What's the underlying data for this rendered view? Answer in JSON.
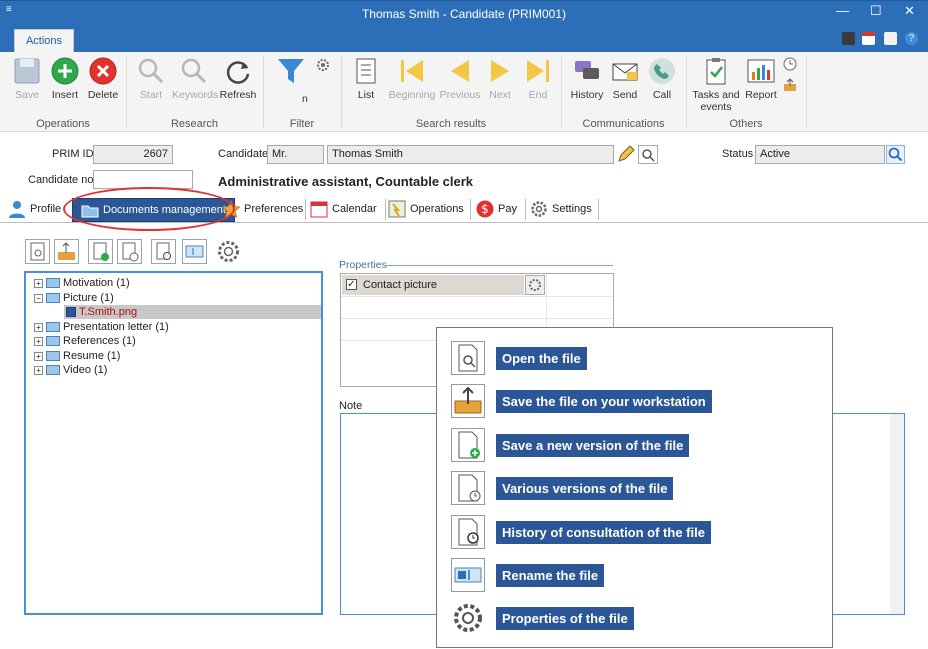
{
  "window": {
    "title": "Thomas Smith - Candidate (PRIM001)",
    "sys_glyph": "≡",
    "min": "—",
    "max": "☐",
    "close": "✕"
  },
  "ribbon_tab": "Actions",
  "ribbon": {
    "operations": {
      "label": "Operations",
      "save": "Save",
      "insert": "Insert",
      "delete": "Delete"
    },
    "research": {
      "label": "Research",
      "start": "Start",
      "keywords": "Keywords",
      "refresh": "Refresh"
    },
    "filter": {
      "label": "Filter",
      "n": "n"
    },
    "search_results": {
      "label": "Search results",
      "list": "List",
      "beginning": "Beginning",
      "previous": "Previous",
      "next": "Next",
      "end": "End"
    },
    "communications": {
      "label": "Communications",
      "history": "History",
      "send": "Send",
      "call": "Call"
    },
    "others": {
      "label": "Others",
      "tasks": "Tasks and events",
      "report": "Report"
    }
  },
  "header": {
    "prim_id_label": "PRIM ID",
    "prim_id": "2607",
    "candidate_label": "Candidate",
    "title_value": "Mr.",
    "name_value": "Thomas Smith",
    "status_label": "Status",
    "status_value": "Active",
    "candidate_no_label": "Candidate no.",
    "candidate_no_value": "",
    "job_title": "Administrative assistant, Countable clerk"
  },
  "tabs": [
    "Profile",
    "Documents management",
    "Preferences",
    "Calendar",
    "Operations",
    "Pay",
    "Settings"
  ],
  "tree": [
    {
      "label": "Motivation (1)",
      "sign": "+"
    },
    {
      "label": "Picture (1)",
      "sign": "−"
    },
    {
      "label": "T.Smith.png",
      "sign": ""
    },
    {
      "label": "Presentation letter (1)",
      "sign": "+"
    },
    {
      "label": "References (1)",
      "sign": "+"
    },
    {
      "label": "Resume (1)",
      "sign": "+"
    },
    {
      "label": "Video (1)",
      "sign": "+"
    }
  ],
  "properties": {
    "title": "Properties",
    "item": "Contact picture",
    "checked": true
  },
  "note_label": "Note",
  "legend": [
    {
      "label": "Open the file",
      "icon": "open-file-icon"
    },
    {
      "label": "Save the file on your workstation",
      "icon": "save-to-workstation-icon"
    },
    {
      "label": "Save a new version of the file",
      "icon": "new-version-icon"
    },
    {
      "label": "Various versions of the file",
      "icon": "versions-icon"
    },
    {
      "label": "History of consultation of the file",
      "icon": "consultation-history-icon"
    },
    {
      "label": "Rename the file",
      "icon": "rename-icon"
    },
    {
      "label": "Properties of the file",
      "icon": "properties-gear-icon"
    }
  ],
  "colors": {
    "titlebar": "#2c6fb8",
    "active_tab": "#2b5797",
    "highlight_ring": "#e0322e",
    "insert": "#2ea84a",
    "delete": "#e0322e"
  }
}
